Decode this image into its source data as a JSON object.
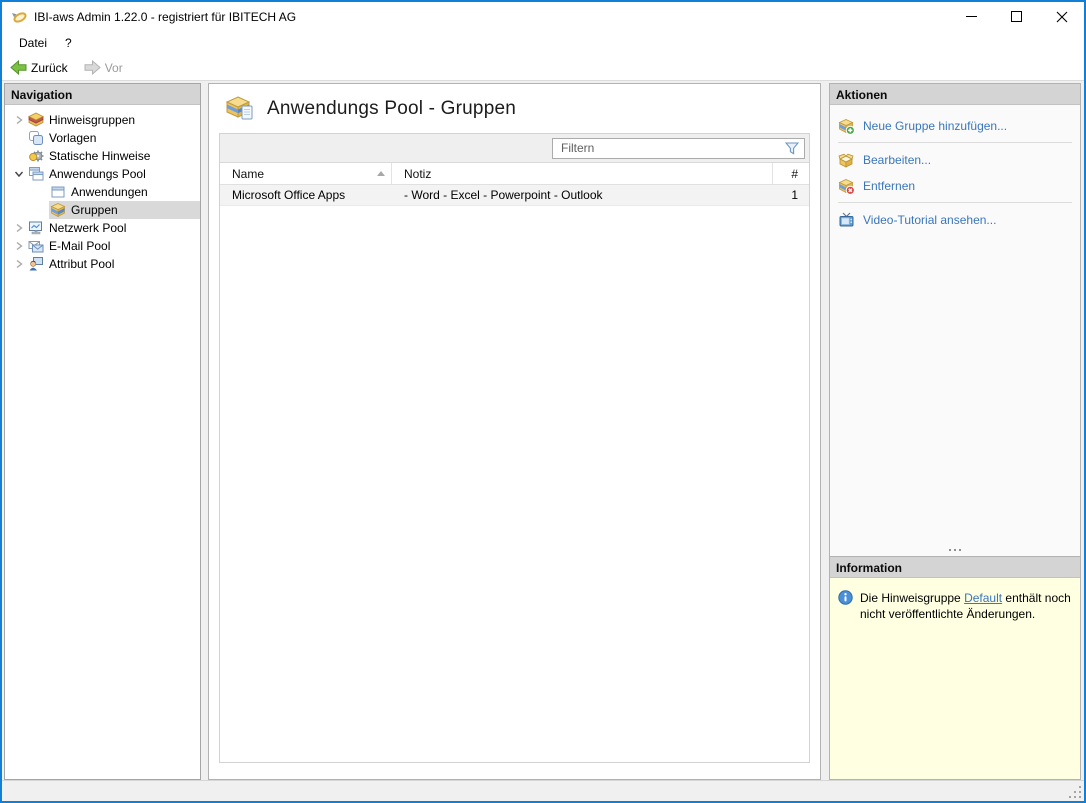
{
  "window": {
    "title": "IBI-aws Admin 1.22.0 - registriert für IBITECH AG"
  },
  "menu": {
    "items": [
      {
        "label": "Datei"
      },
      {
        "label": "?"
      }
    ]
  },
  "toolbar": {
    "back_label": "Zurück",
    "forward_label": "Vor"
  },
  "navigation": {
    "header": "Navigation",
    "items": [
      {
        "label": "Hinweisgruppen",
        "state": "collapsed"
      },
      {
        "label": "Vorlagen",
        "state": "leaf"
      },
      {
        "label": "Statische Hinweise",
        "state": "leaf"
      },
      {
        "label": "Anwendungs Pool",
        "state": "expanded"
      },
      {
        "label": "Anwendungen",
        "state": "leaf",
        "child": true
      },
      {
        "label": "Gruppen",
        "state": "leaf",
        "child": true,
        "selected": true
      },
      {
        "label": "Netzwerk Pool",
        "state": "collapsed"
      },
      {
        "label": "E-Mail Pool",
        "state": "collapsed"
      },
      {
        "label": "Attribut Pool",
        "state": "collapsed"
      }
    ]
  },
  "main": {
    "title": "Anwendungs Pool - Gruppen",
    "filter_placeholder": "Filtern",
    "table": {
      "columns": [
        "Name",
        "Notiz",
        "#"
      ],
      "sort": {
        "column": "Name",
        "direction": "ascending"
      },
      "rows": [
        {
          "name": "Microsoft Office Apps",
          "notiz": "- Word - Excel - Powerpoint - Outlook",
          "count": "1"
        }
      ]
    }
  },
  "actions": {
    "header": "Aktionen",
    "items": [
      {
        "label": "Neue Gruppe hinzufügen..."
      },
      {
        "label": "Bearbeiten..."
      },
      {
        "label": "Entfernen"
      },
      {
        "label": "Video-Tutorial ansehen..."
      }
    ]
  },
  "information": {
    "header": "Information",
    "text_before": "Die Hinweisgruppe ",
    "link_text": "Default",
    "text_after": " enthält noch nicht veröffentlichte Änderungen."
  },
  "colors": {
    "accent_border": "#0078d7",
    "link": "#3a76bb",
    "selection": "#d9d9d9",
    "section_header_bg": "#d4d4d4",
    "info_bg": "#ffffe1"
  }
}
